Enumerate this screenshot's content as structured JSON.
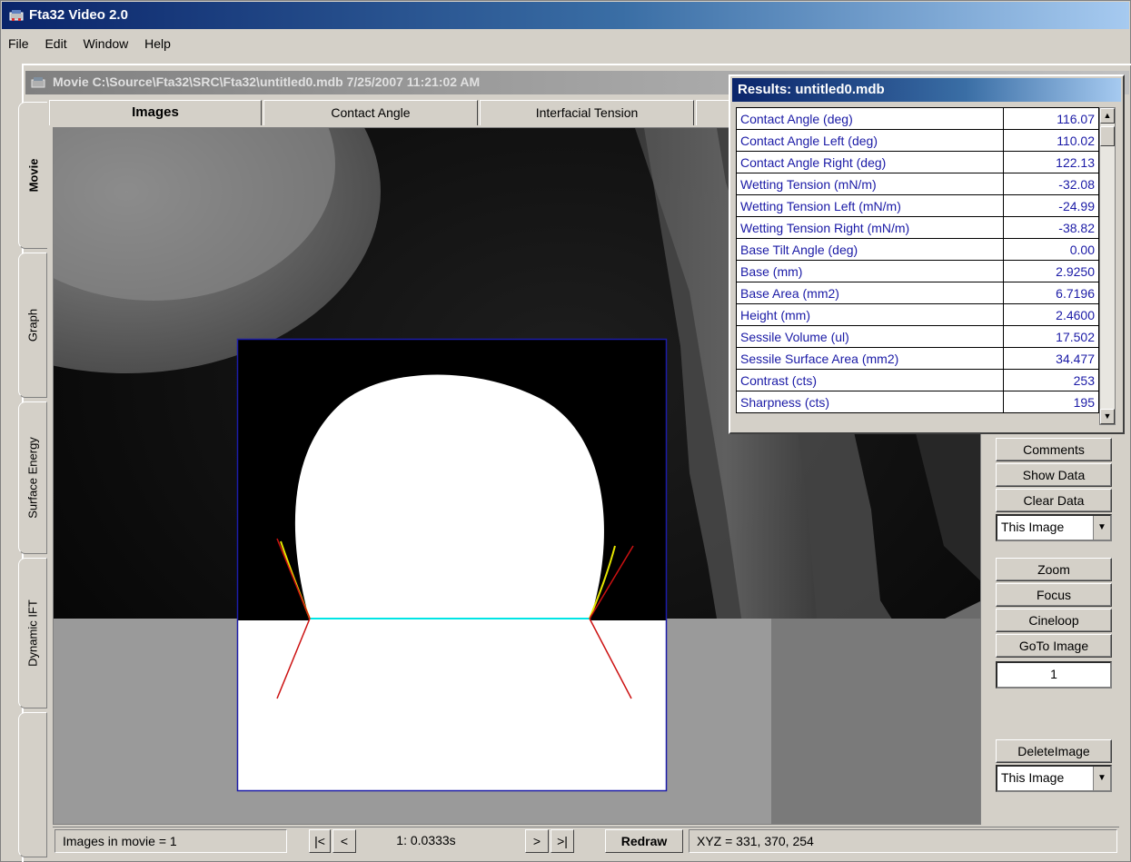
{
  "app": {
    "title": "Fta32 Video 2.0"
  },
  "menu": [
    "File",
    "Edit",
    "Window",
    "Help"
  ],
  "document": {
    "title": "Movie C:\\Source\\Fta32\\SRC\\Fta32\\untitled0.mdb 7/25/2007 11:21:02 AM"
  },
  "side_tabs": [
    {
      "label": "Movie",
      "active": true
    },
    {
      "label": "Graph",
      "active": false
    },
    {
      "label": "Surface Energy",
      "active": false
    },
    {
      "label": "Dynamic IFT",
      "active": false
    }
  ],
  "top_tabs": [
    {
      "label": "Images",
      "active": true
    },
    {
      "label": "Contact Angle",
      "active": false
    },
    {
      "label": "Interfacial Tension",
      "active": false
    }
  ],
  "results": {
    "title": "Results: untitled0.mdb",
    "rows": [
      {
        "label": "Contact Angle (deg)",
        "value": "116.07"
      },
      {
        "label": "Contact Angle Left (deg)",
        "value": "110.02"
      },
      {
        "label": "Contact Angle Right (deg)",
        "value": "122.13"
      },
      {
        "label": "Wetting Tension (mN/m)",
        "value": "-32.08"
      },
      {
        "label": "Wetting Tension Left (mN/m)",
        "value": "-24.99"
      },
      {
        "label": "Wetting Tension Right (mN/m)",
        "value": "-38.82"
      },
      {
        "label": "Base Tilt Angle (deg)",
        "value": "0.00"
      },
      {
        "label": "Base (mm)",
        "value": "2.9250"
      },
      {
        "label": "Base Area (mm2)",
        "value": "6.7196"
      },
      {
        "label": "Height (mm)",
        "value": "2.4600"
      },
      {
        "label": "Sessile Volume (ul)",
        "value": "17.502"
      },
      {
        "label": "Sessile Surface Area (mm2)",
        "value": "34.477"
      },
      {
        "label": "Contrast (cts)",
        "value": "253"
      },
      {
        "label": "Sharpness (cts)",
        "value": "195"
      }
    ]
  },
  "right_panel": {
    "comments": "Comments",
    "show_data": "Show Data",
    "clear_data": "Clear Data",
    "scope_select": "This Image",
    "zoom": "Zoom",
    "focus": "Focus",
    "cineloop": "Cineloop",
    "goto_image": "GoTo Image",
    "image_number": "1",
    "delete_image": "DeleteImage",
    "delete_scope_select": "This Image"
  },
  "status": {
    "images_in_movie": "Images in movie = 1",
    "first": "|<",
    "prev": "<",
    "frame_time": "1:  0.0333s",
    "next": ">",
    "last": ">|",
    "redraw": "Redraw",
    "xyz": "XYZ = 331, 370, 254"
  },
  "colors": {
    "titlebar": "#0a246a",
    "roi_box": "#1c1ca8",
    "baseline": "#00e5e5",
    "tangent": "#cc1111",
    "fit_curve": "#e6e600"
  }
}
